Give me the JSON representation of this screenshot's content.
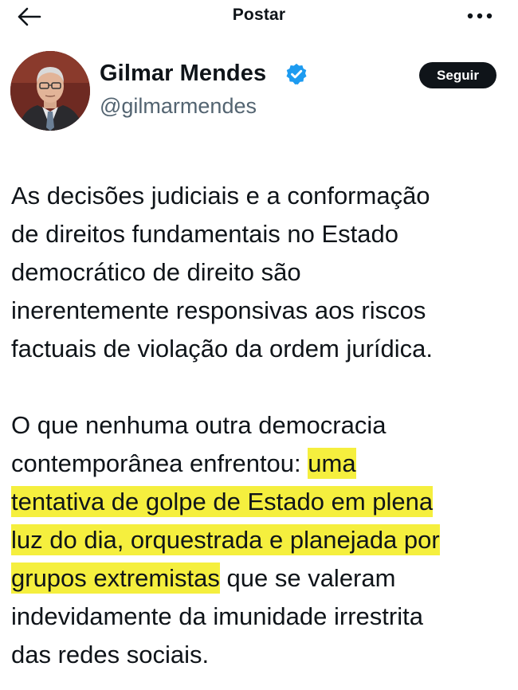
{
  "header": {
    "title": "Postar",
    "back_icon": "arrow-left-icon",
    "more_icon": "more-horizontal-icon"
  },
  "author": {
    "name": "Gilmar Mendes",
    "handle": "@gilmarmendes",
    "verified": true,
    "verified_color": "#1d9bf0",
    "follow_label": "Seguir"
  },
  "tweet": {
    "paragraph1": [
      "As decisões judiciais e a conformação",
      "de direitos fundamentais no Estado",
      "democrático de direito são",
      "inerentemente responsivas aos riscos",
      "factuais de violação da ordem jurídica."
    ],
    "paragraph2": {
      "line1": "O que nenhuma outra democracia",
      "line2_plain": "contemporânea enfrentou: ",
      "line2_hl": "uma",
      "line3_hl": "tentativa de golpe de Estado em plena",
      "line4_hl": "luz do dia, orquestrada e planejada por",
      "line5_hl": "grupos extremistas",
      "line5_plain": " que se valeram",
      "line6": "indevidamente da imunidade irrestrita",
      "line7": "das redes sociais."
    },
    "highlight_color": "#f5ef3e"
  }
}
